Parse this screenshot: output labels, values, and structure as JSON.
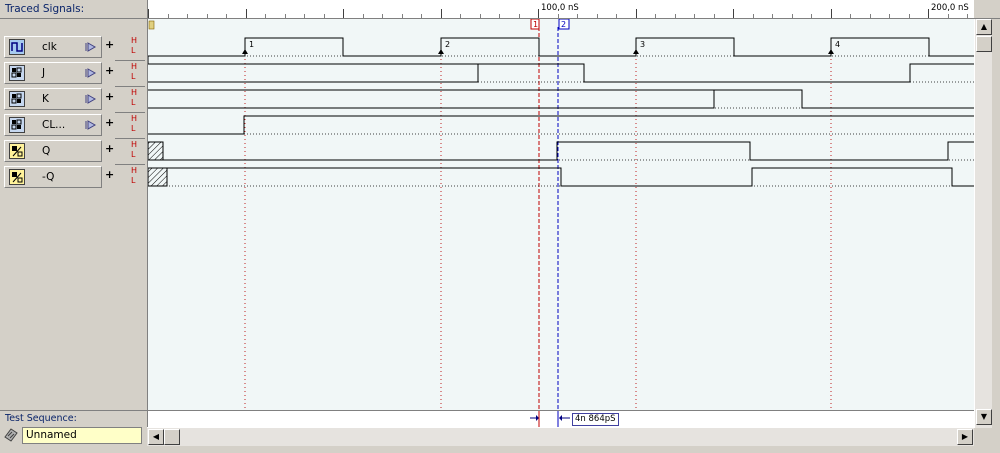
{
  "header": {
    "title": "Traced Signals:",
    "ruler": {
      "label_100": "100,0 nS",
      "label_200": "200,0 nS"
    }
  },
  "signals": [
    {
      "name": "clk",
      "icon": "clock-source-icon",
      "hl_high": "H",
      "hl_low": "L"
    },
    {
      "name": "J",
      "icon": "register-icon",
      "hl_high": "H",
      "hl_low": "L"
    },
    {
      "name": "K",
      "icon": "register-icon",
      "hl_high": "H",
      "hl_low": "L"
    },
    {
      "name": "CL...",
      "icon": "register-icon",
      "hl_high": "H",
      "hl_low": "L"
    },
    {
      "name": "Q",
      "icon": "output-icon",
      "hl_high": "H",
      "hl_low": "L"
    },
    {
      "name": "-Q",
      "icon": "output-icon",
      "hl_high": "H",
      "hl_low": "L"
    }
  ],
  "clock_edges": [
    "1",
    "2",
    "3",
    "4"
  ],
  "cursors": {
    "cursor_1": "1",
    "cursor_2": "2"
  },
  "measurement": "4n 864pS",
  "test_sequence": {
    "label": "Test Sequence:",
    "value": "Unnamed"
  },
  "colors": {
    "wave_bg": "#f1f7f7",
    "cursor_red": "#c00000",
    "cursor_blue": "#0000c0",
    "hl_label": "#c00000",
    "title_blue": "#0a246a"
  }
}
